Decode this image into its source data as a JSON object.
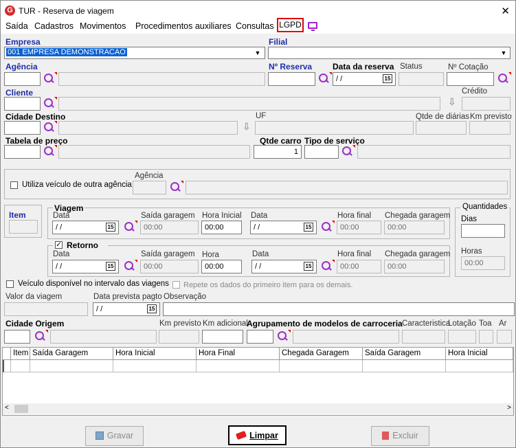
{
  "window": {
    "title": "TUR - Reserva de viagem",
    "app_icon": "G",
    "close": "✕"
  },
  "menu": [
    "Saída",
    "Cadastros",
    "Movimentos",
    "Procedimentos auxiliares",
    "Consultas",
    "LGPD"
  ],
  "labels": {
    "empresa": "Empresa",
    "filial": "Filial",
    "agencia": "Agência",
    "nreserva": "Nº Reserva",
    "data_reserva": "Data da reserva",
    "status": "Status",
    "ncotacao": "Nº Cotação",
    "cliente": "Cliente",
    "credito": "Crédito",
    "cidade_destino": "Cidade Destino",
    "uf": "UF",
    "qtde_diarias": "Qtde de diárias",
    "km_previsto": "Km previsto",
    "tabela_preco": "Tabela de preço",
    "qtde_carro": "Qtde carro",
    "tipo_servico": "Tipo de serviço",
    "utiliza": "Utiliza veículo de outra agência",
    "agencia2": "Agência",
    "item": "Item",
    "viagem": "Viagem",
    "retorno": "Retorno",
    "data": "Data",
    "saida_garagem": "Saída garagem",
    "hora_inicial": "Hora Inicial",
    "hora": "Hora",
    "hora_final": "Hora final",
    "chegada_garagem": "Chegada garagem",
    "quantidades": "Quantidades",
    "dias": "Dias",
    "horas": "Horas",
    "veiculo_disp": "Veículo disponível no intervalo das viagens",
    "repete": "Repete os dados do primeiro item para os demais.",
    "valor_viagem": "Valor da viagem",
    "data_prevista": "Data prevista pagto",
    "observacao": "Observação",
    "cidade_origem": "Cidade Origem",
    "km_previsto2": "Km previsto",
    "km_adicional": "Km adicional",
    "agrupamento": "Agrupamento de modelos de carroceria",
    "caracteristica": "Caracteristica",
    "lotacao": "Lotação",
    "toa": "Toa",
    "ar": "Ar"
  },
  "values": {
    "empresa": "001 EMPRESA DEMONSTRACAO",
    "date_empty": "/ /",
    "time_empty": "00:00",
    "qtde_carro": "1",
    "horas": "00:00"
  },
  "grid": {
    "columns": [
      "Item",
      "Saída Garagem",
      "Hora Inicial",
      "Hora Final",
      "Chegada Garagem",
      "Saída Garagem",
      "Hora Inicial"
    ]
  },
  "buttons": {
    "gravar": "Gravar",
    "limpar": "Limpar",
    "excluir": "Excluir"
  },
  "colors": {
    "label_blue": "#1e2ea8",
    "accent_purple": "#9b2fc9",
    "lgpd_border": "#e00000"
  }
}
